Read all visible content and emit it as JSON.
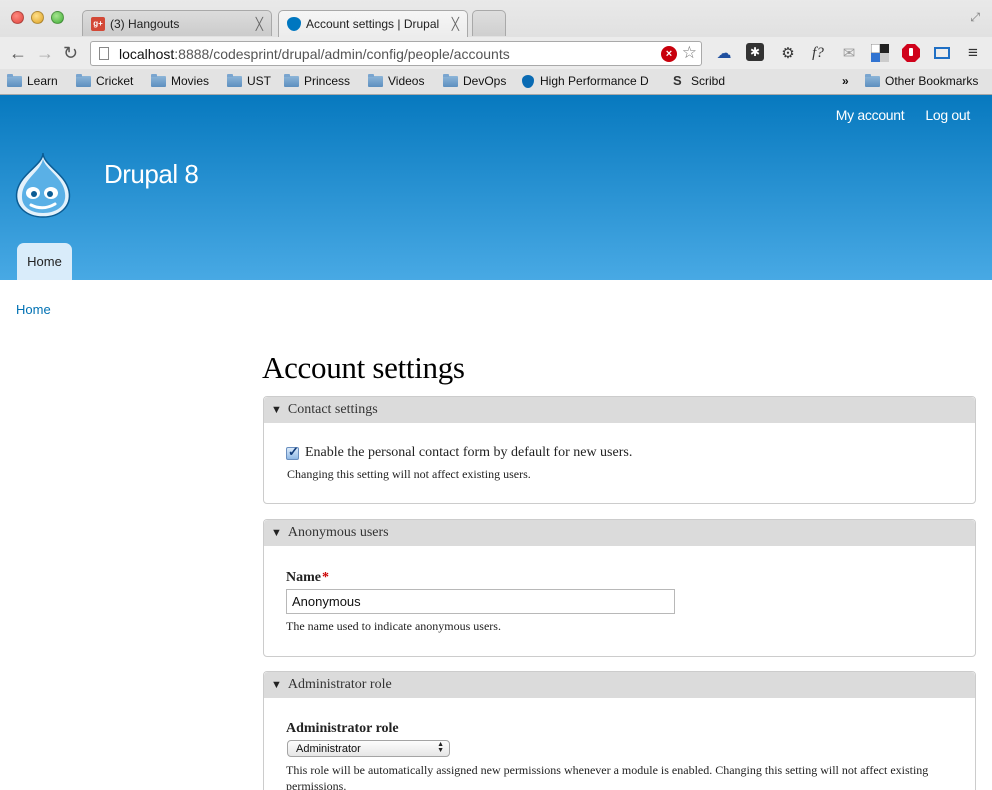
{
  "browser": {
    "tabs": [
      {
        "title": "(3) Hangouts",
        "close": "╳"
      },
      {
        "title": "Account settings | Drupal",
        "close": "╳"
      }
    ],
    "url_host": "localhost",
    "url_path": ":8888/codesprint/drupal/admin/config/people/accounts",
    "bookmarks": [
      "Learn",
      "Cricket",
      "Movies",
      "UST",
      "Princess",
      "Videos",
      "DevOps",
      "High Performance D",
      "Scribd"
    ],
    "more_bookmarks": "»",
    "other_bookmarks": "Other Bookmarks"
  },
  "site": {
    "name": "Drupal 8",
    "user_menu": {
      "my_account": "My account",
      "log_out": "Log out"
    },
    "primary_tab": "Home",
    "breadcrumb": "Home"
  },
  "page": {
    "title": "Account settings",
    "contact": {
      "legend": "Contact settings",
      "checkbox_label": "Enable the personal contact form by default for new users.",
      "checked": true,
      "description": "Changing this setting will not affect existing users."
    },
    "anonymous": {
      "legend": "Anonymous users",
      "name_label": "Name",
      "required_marker": "*",
      "name_value": "Anonymous",
      "description": "The name used to indicate anonymous users."
    },
    "admin_role": {
      "legend": "Administrator role",
      "label": "Administrator role",
      "selected": "Administrator",
      "description": "This role will be automatically assigned new permissions whenever a module is enabled. Changing this setting will not affect existing permissions."
    }
  },
  "colors": {
    "header_top": "#0779bf",
    "header_bottom": "#48a9e4",
    "link": "#0071b3",
    "legend_bg": "#dbdbdb"
  }
}
